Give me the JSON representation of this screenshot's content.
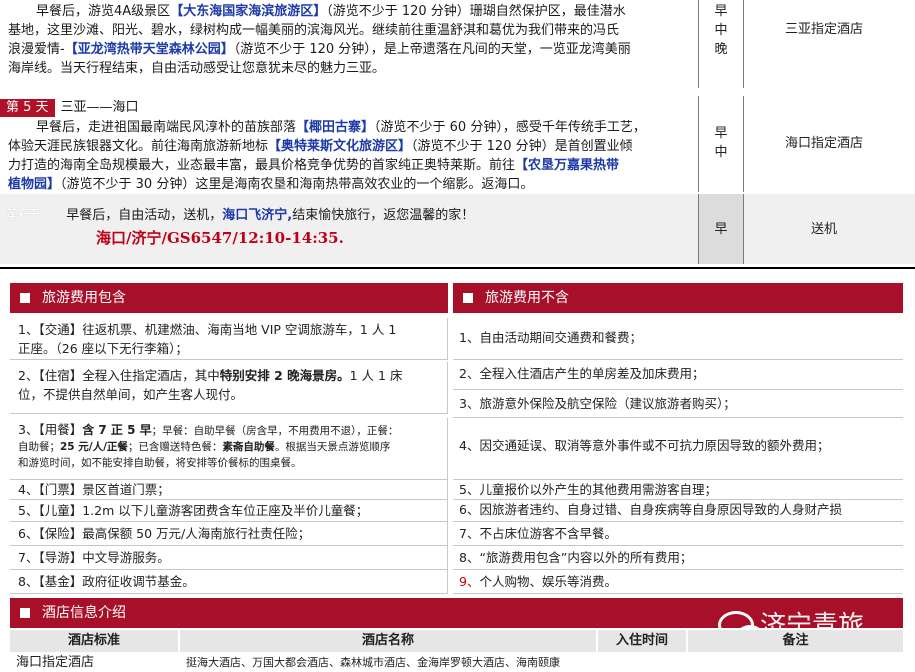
{
  "day4": {
    "p1a": "早餐后，游览",
    "p1b": "4A级景区",
    "p1c": "【大东海国家海滨旅游区】",
    "p1d": "（游览不少于 120 分钟）珊瑚自然保护区，最佳潜水",
    "line2": "基地，这里沙滩、阳光、碧水，绿树构成一幅美丽的滨海风光。继续前往重温舒淇和葛优为我们带来的冯氏",
    "line3a": "浪漫爱情-",
    "line3b": "【亚龙湾热带天堂森林公园】",
    "line3c": "（游览不少于 120 分钟），是上帝遗落在凡间的天堂，一览亚龙湾美丽",
    "line4": "海岸线。当天行程结束，自由活动感受让您意犹未尽的魅力三亚。",
    "meals": [
      "早",
      "中",
      "晚"
    ],
    "hotel": "三亚指定酒店"
  },
  "day5": {
    "badge": "第 5 天",
    "route": "三亚——海口",
    "l1a": "早餐后，走进祖国最南端民风淳朴的苗族部落",
    "l1b": "【椰田古寨】",
    "l1c": "（游览不少于 60 分钟），感受千年传统手工艺，",
    "l2a": "体验天涯民族银器文化。前往海南旅游新地标",
    "l2b": "【奥特莱斯文化旅游区】",
    "l2c": "（游览不少于 120 分钟）是首创置业倾",
    "l3a": "力打造的海南全岛规模最大，业态最丰富，最具价格竞争优势的首家纯正奥特莱斯。前往",
    "l3b": "【农垦万嘉果热带",
    "l4a": "植物园】",
    "l4b": "（游览不少于 30 分钟）这里是海南农垦和海南热带高效农业的一个缩影。返海口。",
    "meals": [
      "早",
      "中"
    ],
    "hotel": "海口指定酒店"
  },
  "day6": {
    "badge": "第6天",
    "t1": "早餐后，自由活动，送机，",
    "t2": "海口飞济宁,",
    "t3": "结束愉快旅行，返您温馨的家！",
    "flight": "海口/济宁/GS6547/12:10-14:35.",
    "meal": "早",
    "hotel": "送机"
  },
  "included": {
    "title": "旅游费用包含",
    "i1a": "1、【交通】往返机票、机建燃油、海南当地 VIP 空调旅游车，1 人 1",
    "i1b": "正座。（26 座以下无行李箱）；",
    "i2a": "2、【住宿】全程入住指定酒店，其中",
    "i2b": "特别安排 2 晚海景房。",
    "i2c": "1 人 1 床",
    "i2d": "位，不提供自然单间，如产生客人现付。",
    "i3a": "3、【用餐】",
    "i3b": "含 7 正 5 早",
    "i3c": "；早餐：自助早餐（房含早，不用费用不退），正餐：",
    "i3d": "自助餐；",
    "i3e": "25 元/人/正餐",
    "i3f": "；已含赠送特色餐：",
    "i3g": "素斋自助餐",
    "i3h": "。根据当天景点游览顺序",
    "i3i": "和游览时间，如不能安排自助餐，将安排等价餐标的围桌餐。",
    "i4": "4、【门票】景区首道门票；",
    "i5": "5、【儿童】1.2m 以下儿童游客团费含车位正座及半价儿童餐；",
    "i6": "6、【保险】最高保额 50 万元/人海南旅行社责任险；",
    "i7": "7、【导游】中文导游服务。",
    "i8": "8、【基金】政府征收调节基金。"
  },
  "excluded": {
    "title": "旅游费用不含",
    "e1": "1、自由活动期间交通费和餐费；",
    "e2": "2、全程入住酒店产生的单房差及加床费用；",
    "e3": "3、旅游意外保险及航空保险（建议旅游者购买）；",
    "e4": "4、因交通延误、取消等意外事件或不可抗力原因导致的额外费用；",
    "e5": "5、儿童报价以外产生的其他费用需游客自理；",
    "e6a": "6、因旅游者违约、自身过错、自身疾病等自身原因导致的人身财产损",
    "e7": "7、不占床位游客不含早餐。",
    "e8": "8、“旅游费用包含”内容以外的所有费用；",
    "e9n": "9、",
    "e9": "个人购物、娱乐等消费。"
  },
  "hotel_info": {
    "title": "酒店信息介绍",
    "headers": [
      "酒店标准",
      "酒店名称",
      "入住时间",
      "备注"
    ],
    "row1_std": "海口指定酒店",
    "row1_name": "挺海大酒店、万国大都会酒店、森林城市酒店、金海岸罗顿大酒店、海南颐康"
  },
  "watermark": "济宁青旅"
}
